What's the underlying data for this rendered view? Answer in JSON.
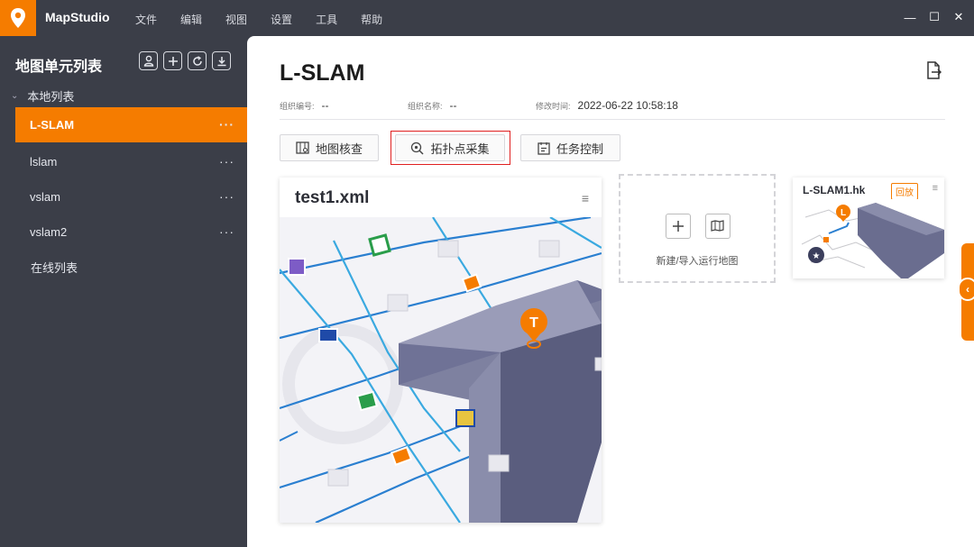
{
  "app": {
    "name": "MapStudio"
  },
  "menu": [
    "文件",
    "编辑",
    "视图",
    "设置",
    "工具",
    "帮助"
  ],
  "window_controls": {
    "minimize": "—",
    "maximize": "☐",
    "close": "✕"
  },
  "sidebar": {
    "title": "地图单元列表",
    "tools": [
      "user-icon",
      "plus-icon",
      "refresh-icon",
      "download-icon"
    ],
    "local_group": "本地列表",
    "items": [
      {
        "label": "L-SLAM",
        "active": true
      },
      {
        "label": "lslam",
        "active": false
      },
      {
        "label": "vslam",
        "active": false
      },
      {
        "label": "vslam2",
        "active": false
      }
    ],
    "more_label": "···",
    "online_group": "在线列表"
  },
  "main": {
    "title": "L-SLAM",
    "meta": {
      "org_id_label": "组织编号:",
      "org_id_value": "--",
      "org_name_label": "组织名称:",
      "org_name_value": "--",
      "modified_label": "修改时间:",
      "modified_value": "2022-06-22 10:58:18"
    },
    "tabs": [
      {
        "label": "地图核查",
        "icon": "map-check-icon"
      },
      {
        "label": "拓扑点采集",
        "icon": "topology-collect-icon",
        "highlighted": true
      },
      {
        "label": "任务控制",
        "icon": "task-control-icon"
      }
    ],
    "map_card": {
      "name": "test1.xml",
      "menu": "≡",
      "marker_letter": "T"
    },
    "new_card": {
      "label": "新建/导入运行地图"
    },
    "mini_card": {
      "name": "L-SLAM1.hk",
      "badge": "回放",
      "menu": "≡",
      "marker_letter": "L"
    }
  },
  "colors": {
    "accent": "#f57c00",
    "sidebar_bg": "#3b3e48",
    "highlight": "#e02020",
    "road": "#2a7fd0"
  }
}
